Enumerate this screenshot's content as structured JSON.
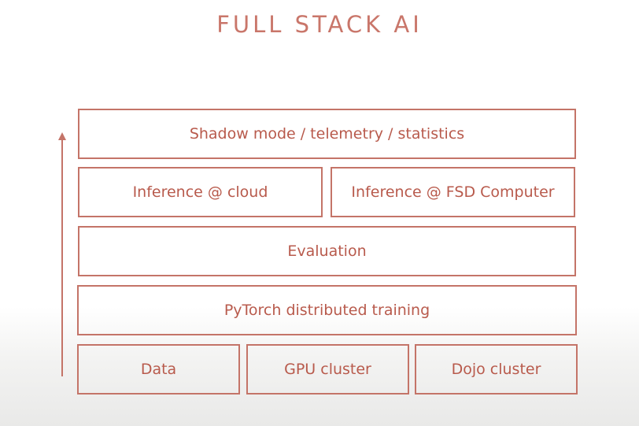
{
  "title": "FULL STACK AI",
  "layers": {
    "top": "Shadow mode / telemetry / statistics",
    "inference": [
      "Inference @ cloud",
      "Inference @ FSD Computer"
    ],
    "evaluation": "Evaluation",
    "training": "PyTorch distributed training",
    "foundation": [
      "Data",
      "GPU cluster",
      "Dojo cluster"
    ]
  },
  "colors": {
    "accent": "#c47468",
    "text": "#b85a4c",
    "title": "#c9766a"
  },
  "icons": {
    "arrow": "up-arrow-icon"
  }
}
